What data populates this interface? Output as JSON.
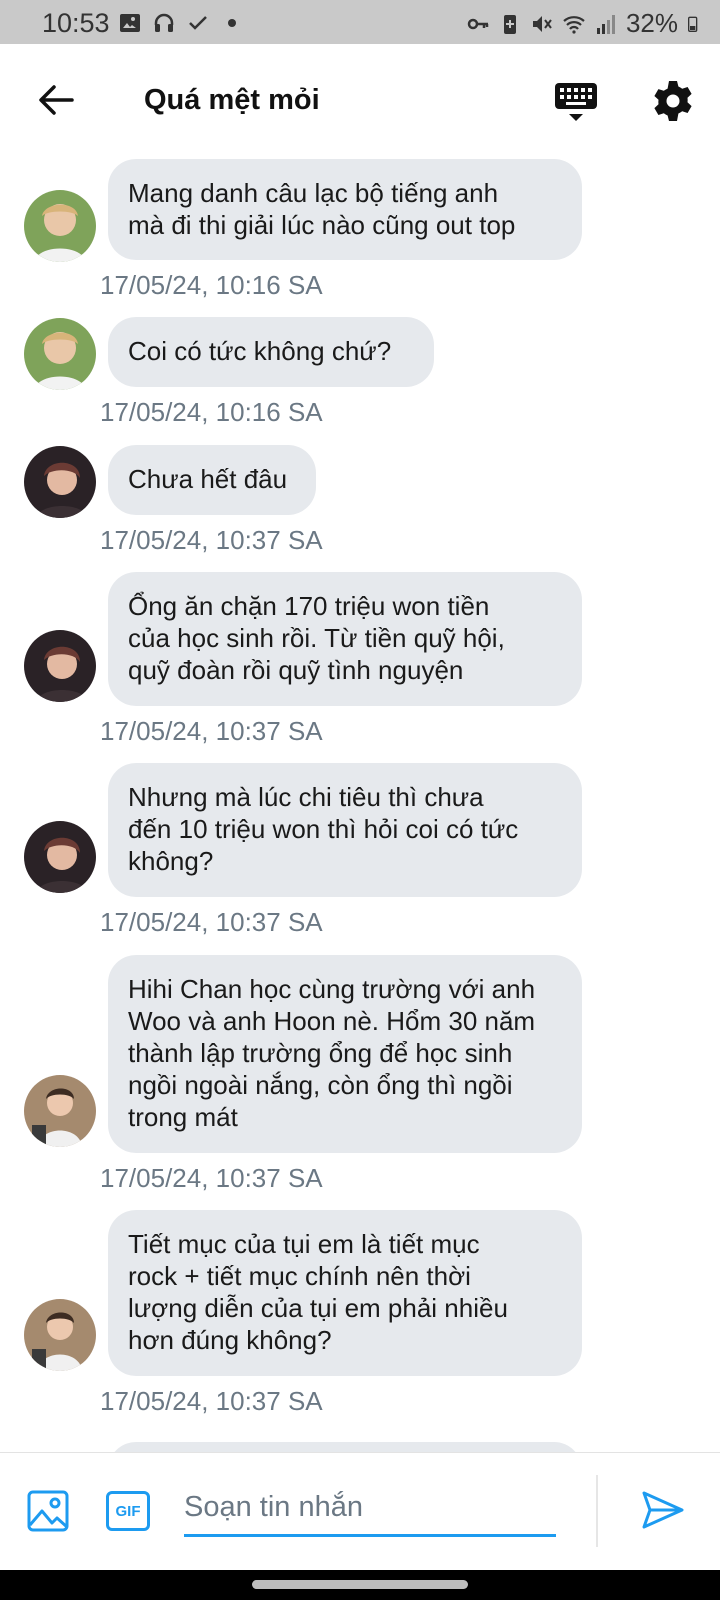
{
  "status": {
    "time": "10:53",
    "battery": "32%",
    "left_icons": [
      "image-icon",
      "headphones-icon",
      "check-icon",
      "dot-icon"
    ],
    "right_icons": [
      "key-icon",
      "battery-saver-icon",
      "mute-icon",
      "wifi-icon",
      "signal-icon",
      "battery-icon"
    ]
  },
  "header": {
    "title": "Quá mệt mỏi"
  },
  "messages": [
    {
      "text": "Mang danh câu lạc bộ tiếng anh\nmà đi thi giải lúc nào cũng out top",
      "timestamp": "17/05/24, 10:16 SA",
      "avatar": "avatar-a"
    },
    {
      "text": "Coi có tức không chứ?",
      "timestamp": "17/05/24, 10:16 SA",
      "avatar": "avatar-a"
    },
    {
      "text": "Chưa hết đâu",
      "timestamp": "17/05/24, 10:37 SA",
      "avatar": "avatar-b"
    },
    {
      "text": "Ổng ăn chặn 170 triệu won tiền\ncủa học sinh rồi. Từ tiền quỹ hội,\nquỹ đoàn rồi quỹ tình nguyện",
      "timestamp": "17/05/24, 10:37 SA",
      "avatar": "avatar-b"
    },
    {
      "text": "Nhưng mà lúc chi tiêu thì chưa\nđến 10 triệu won thì hỏi coi có tức\nkhông?",
      "timestamp": "17/05/24, 10:37 SA",
      "avatar": "avatar-b"
    },
    {
      "text": "Hihi Chan học cùng trường với anh\nWoo và anh Hoon nè. Hổm 30 năm\nthành lập trường ổng để học sinh\nngồi ngoài nắng, còn ổng thì ngồi\ntrong mát",
      "timestamp": "17/05/24, 10:37 SA",
      "avatar": "avatar-c"
    },
    {
      "text": "Tiết mục của tụi em là tiết mục\nrock + tiết mục chính nên thời\nlượng diễn của tụi em phải nhiều\nhơn đúng không?",
      "timestamp": "17/05/24, 10:37 SA",
      "avatar": "avatar-c"
    }
  ],
  "composer": {
    "placeholder": "Soạn tin nhắn",
    "gif_label": "GIF"
  },
  "colors": {
    "accent": "#1d9bf0",
    "bubble": "#e6e9ed",
    "timestamp": "#6b7884",
    "status_bar": "#c9c9c9"
  }
}
